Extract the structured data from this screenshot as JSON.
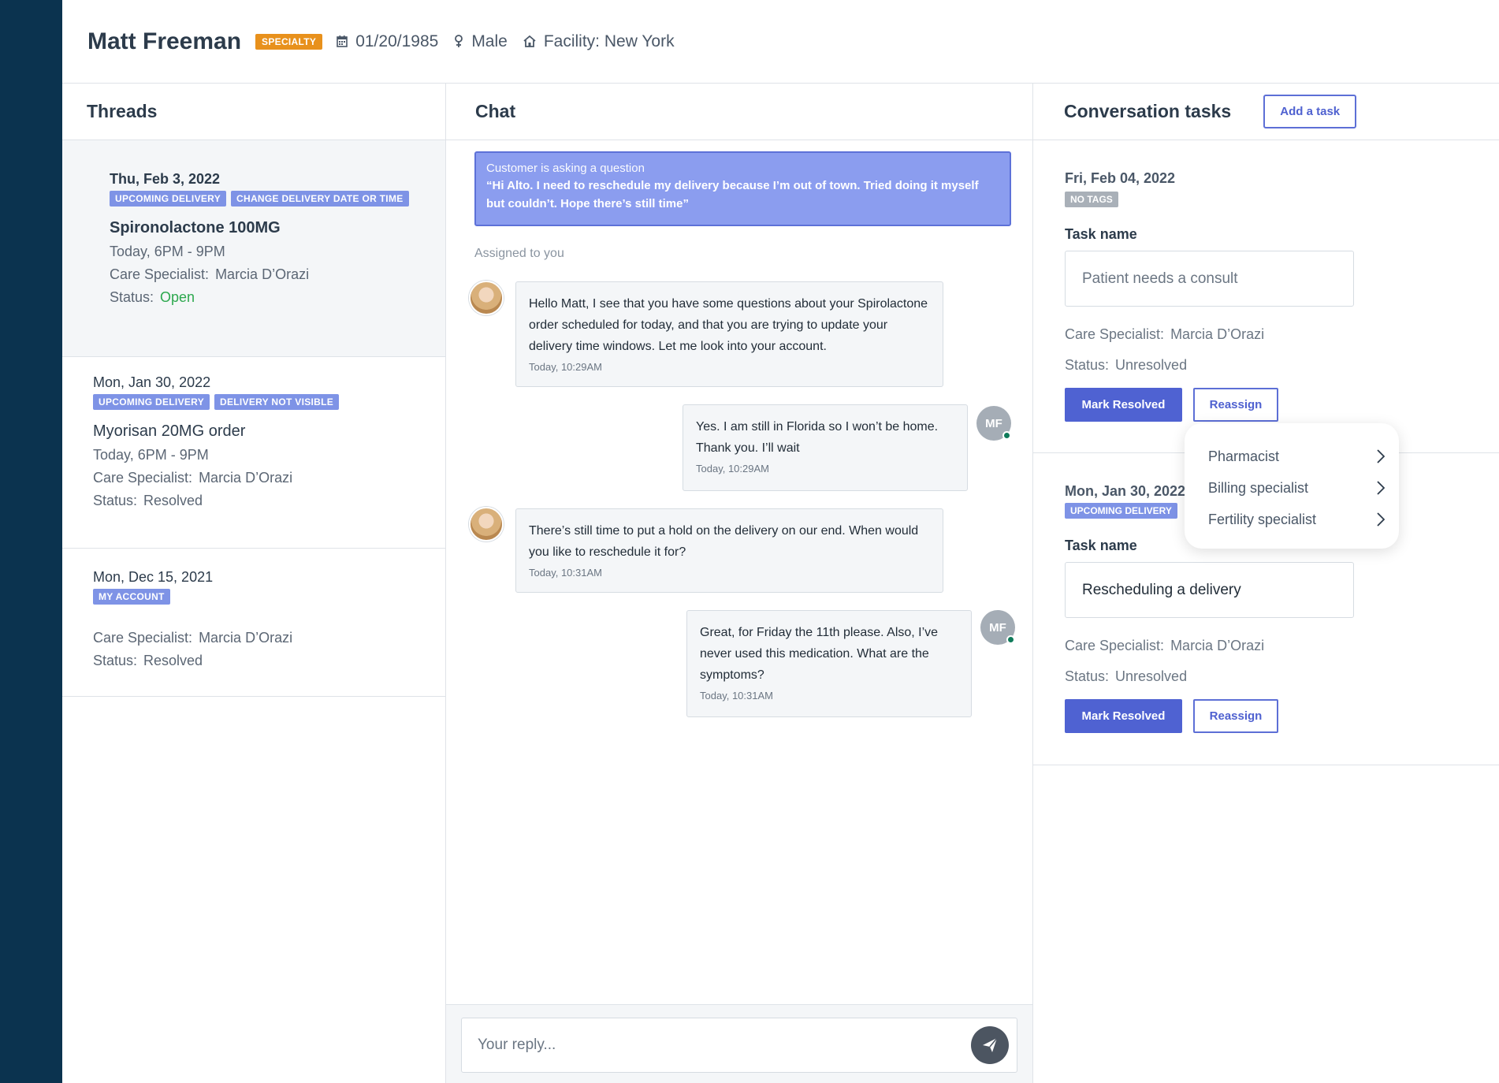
{
  "patient": {
    "name": "Matt Freeman",
    "badge": "SPECIALTY",
    "dob": "01/20/1985",
    "gender": "Male",
    "facility": "Facility: New York"
  },
  "threads": {
    "title": "Threads",
    "items": [
      {
        "date": "Thu, Feb 3, 2022",
        "tags": [
          "UPCOMING DELIVERY",
          "CHANGE DELIVERY DATE OR TIME"
        ],
        "title": "Spironolactone 100MG",
        "time": "Today, 6PM - 9PM",
        "specialist_label": "Care Specialist:",
        "specialist": "Marcia D’Orazi",
        "status_label": "Status:",
        "status": "Open"
      },
      {
        "date": "Mon, Jan 30, 2022",
        "tags": [
          "UPCOMING DELIVERY",
          "DELIVERY NOT VISIBLE"
        ],
        "title": "Myorisan 20MG order",
        "time": "Today, 6PM - 9PM",
        "specialist_label": "Care Specialist:",
        "specialist": "Marcia D’Orazi",
        "status_label": "Status:",
        "status": "Resolved"
      },
      {
        "date": "Mon, Dec 15, 2021",
        "tags": [
          "MY ACCOUNT"
        ],
        "specialist_label": "Care Specialist:",
        "specialist": "Marcia D’Orazi",
        "status_label": "Status:",
        "status": "Resolved"
      }
    ]
  },
  "chat": {
    "title": "Chat",
    "question_label": "Customer is asking a question",
    "question_text": "“Hi Alto. I need to reschedule my delivery because I’m out of town. Tried doing it myself but couldn’t. Hope there’s still time”",
    "assigned": "Assigned to you",
    "messages": [
      {
        "from": "agent",
        "text": "Hello Matt, I see that you have some questions about your Spirolactone order scheduled for today, and that you are trying to update your delivery time windows. Let me look into your account.",
        "time": "Today, 10:29AM"
      },
      {
        "from": "patient",
        "initials": "MF",
        "text": "Yes. I am still in Florida so I won’t be home. Thank you. I’ll wait",
        "time": "Today, 10:29AM"
      },
      {
        "from": "agent",
        "text": "There’s still time to put a hold on the delivery on our end. When would you like to reschedule it for?",
        "time": "Today, 10:31AM"
      },
      {
        "from": "patient",
        "initials": "MF",
        "text": "Great, for Friday the 11th please. Also, I’ve never used this medication. What are the symptoms?",
        "time": "Today, 10:31AM"
      }
    ],
    "reply_placeholder": "Your reply..."
  },
  "tasks": {
    "title": "Conversation tasks",
    "add_label": "Add a task",
    "items": [
      {
        "date": "Fri, Feb 04, 2022",
        "tag": "NO TAGS",
        "task_label": "Task name",
        "task_name": "Patient needs a consult",
        "specialist_label": "Care Specialist:",
        "specialist": "Marcia D’Orazi",
        "status_label": "Status:",
        "status": "Unresolved",
        "resolve_label": "Mark Resolved",
        "reassign_label": "Reassign"
      },
      {
        "date": "Mon, Jan 30, 2022",
        "tag": "UPCOMING DELIVERY",
        "task_label": "Task name",
        "task_name": "Rescheduling a delivery",
        "specialist_label": "Care Specialist:",
        "specialist": "Marcia D’Orazi",
        "status_label": "Status:",
        "status": "Unresolved",
        "resolve_label": "Mark Resolved",
        "reassign_label": "Reassign"
      }
    ]
  },
  "reassign_menu": {
    "options": [
      "Pharmacist",
      "Billing specialist",
      "Fertility specialist"
    ]
  },
  "colors": {
    "sidebar": "#0b334f",
    "accent": "#4f62d2",
    "tag": "#7e93e6",
    "badge": "#e8911c",
    "open_status": "#2ca84e"
  }
}
